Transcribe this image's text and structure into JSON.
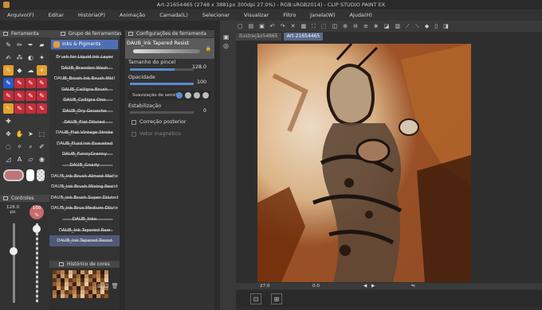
{
  "window": {
    "title": "Art-21654465 (2748 x 3881px 300dpi 27.0%) - RGB:sRGB2014) - CLIP STUDIO PAINT EX"
  },
  "menu": [
    "Arquivo(F)",
    "Editar",
    "História(P)",
    "Animação",
    "Camada(L)",
    "Selecionar",
    "Visualizar",
    "Filtro",
    "Janela(W)",
    "Ajuda(H)"
  ],
  "tool_panel": {
    "title": "Ferramenta"
  },
  "brush_panel": {
    "title": "Grupo de ferramentas",
    "active_tab": "Inks & Pigments",
    "items": [
      "Brush for Liquid Ink Layer",
      "DAUB_Brandon Wash",
      "DAUB_Brush Ink Brush MkII",
      "DAUB_Calligra Brush",
      "DAUB_Calligra One",
      "DAUB_Dry Gouache",
      "DAUB_Flat Diluted",
      "DAUB_Flat Vintage Stroke",
      "DAUB_Fluid Ink Exausted",
      "DAUB_FunnyGranny",
      "DAUB_Gnarly",
      "DAUB_Ink Brush Almost Matte",
      "DAUB_Ink Brush Mixing Resist",
      "DAUB_Ink Brush Super Diluted",
      "DAUB_Ink Brus Medium Dilute",
      "DAUB_Inko",
      "DAUB_Ink Tapered Raw",
      "DAUB_Ink Tapered Resist"
    ],
    "selected_index": 17
  },
  "settings_panel": {
    "title": "Configurações de ferramenta",
    "brush_name": "DAUB_Ink Tapered Resist",
    "brush_size_label": "Tamanho do pincel",
    "brush_size_value": "128.0",
    "opacity_label": "Opacidade",
    "opacity_value": "100",
    "stabilization_tab": "Suavização de sensibi",
    "stabilization_label": "Estabilização",
    "stabilization_value": "0",
    "correction_label": "Correção posterior",
    "vector_label": "Vetor magnético"
  },
  "controls_panel": {
    "title": "Controles",
    "size_value": "128.0",
    "size_unit": "px",
    "opacity_value": "100",
    "opacity_unit": "%"
  },
  "history_panel": {
    "title": "Histórico de cores"
  },
  "canvas": {
    "tabs": [
      "Ilustração54865",
      "Art-21654465"
    ],
    "active_tab": "Art-21654465",
    "zoom": "27.0",
    "angle": "0.0"
  }
}
